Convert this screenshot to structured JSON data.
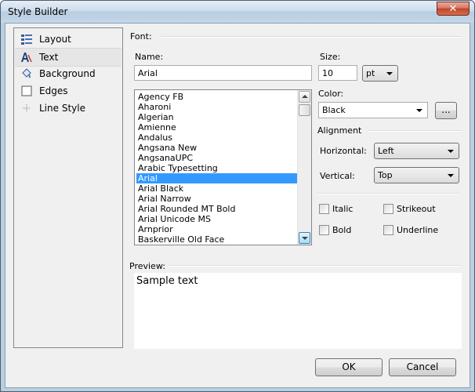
{
  "window": {
    "title": "Style Builder",
    "close_glyph": "✕"
  },
  "nav": {
    "items": [
      {
        "label": "Layout",
        "icon": "layout-icon"
      },
      {
        "label": "Text",
        "icon": "text-icon",
        "selected": true
      },
      {
        "label": "Background",
        "icon": "background-icon"
      },
      {
        "label": "Edges",
        "icon": "edges-icon"
      },
      {
        "label": "Line Style",
        "icon": "line-style-icon"
      }
    ]
  },
  "font": {
    "group_label": "Font:",
    "name_label": "Name:",
    "name_value": "Arial",
    "size_label": "Size:",
    "size_value": "10",
    "unit_value": "pt",
    "color_label": "Color:",
    "color_value": "Black",
    "color_button": "...",
    "font_list": [
      "Agency FB",
      "Aharoni",
      "Algerian",
      "Amienne",
      "Andalus",
      "Angsana New",
      "AngsanaUPC",
      "Arabic Typesetting",
      "Arial",
      "Arial Black",
      "Arial Narrow",
      "Arial Rounded MT Bold",
      "Arial Unicode MS",
      "Arnprior",
      "Baskerville Old Face"
    ],
    "selected_font": "Arial"
  },
  "alignment": {
    "group_label": "Alignment",
    "horizontal_label": "Horizontal:",
    "horizontal_value": "Left",
    "vertical_label": "Vertical:",
    "vertical_value": "Top"
  },
  "effects": {
    "italic": "Italic",
    "strikeout": "Strikeout",
    "bold": "Bold",
    "underline": "Underline"
  },
  "preview": {
    "label": "Preview:",
    "text": "Sample text"
  },
  "buttons": {
    "ok": "OK",
    "cancel": "Cancel"
  },
  "colors": {
    "selection": "#3399ff",
    "dialog_bg": "#f0f0f0"
  }
}
